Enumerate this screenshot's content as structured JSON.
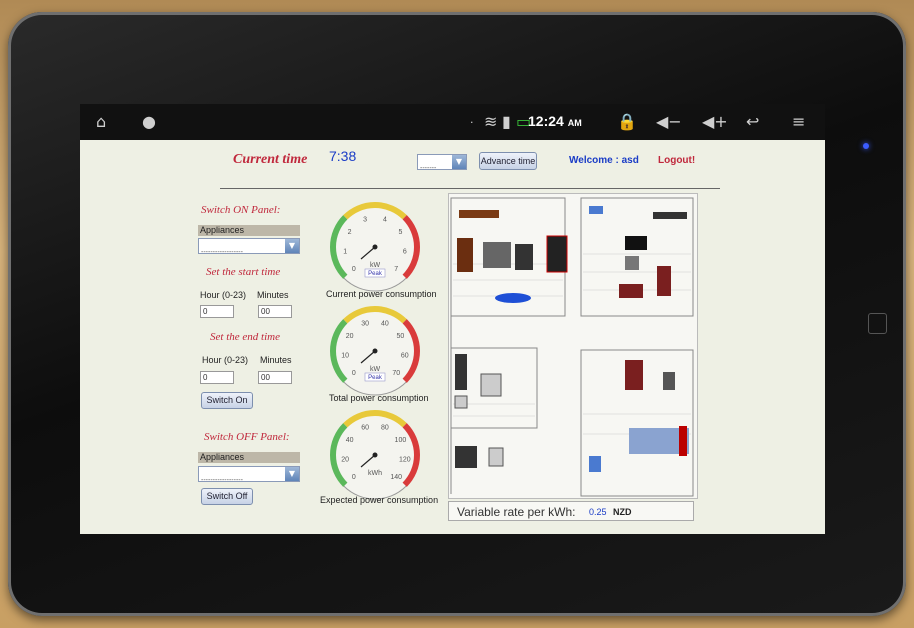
{
  "status_bar": {
    "clock": "12:24",
    "clock_suffix": "AM",
    "icons": [
      "home-icon",
      "android-icon",
      "usb-icon",
      "wifi-icon",
      "signal-icon",
      "battery-icon",
      "lock-icon",
      "volume-down-icon",
      "volume-up-icon",
      "back-icon",
      "menu-icon"
    ]
  },
  "header": {
    "current_time_label": "Current time",
    "current_time_value": "7:38",
    "select_value": "-------",
    "advance_button": "Advance time",
    "welcome": "Welcome : asd",
    "logout": "Logout!"
  },
  "switch_on": {
    "title": "Switch ON Panel:",
    "appliances_label": "Appliances",
    "select_value": "------------------",
    "start_title": "Set the start time",
    "hour_label": "Hour (0-23)",
    "minutes_label": "Minutes",
    "start_hour": "0",
    "start_min": "00",
    "end_title": "Set the end time",
    "end_hour": "0",
    "end_min": "00",
    "button": "Switch On"
  },
  "switch_off": {
    "title": "Switch OFF Panel:",
    "appliances_label": "Appliances",
    "select_value": "------------------",
    "button": "Switch Off"
  },
  "gauges": [
    {
      "caption": "Current power consumption",
      "ticks": [
        "0",
        "1",
        "2",
        "3",
        "4",
        "5",
        "6",
        "7"
      ],
      "unit": "kW",
      "peak": "Peak"
    },
    {
      "caption": "Total power consumption",
      "ticks": [
        "0",
        "10",
        "20",
        "30",
        "40",
        "50",
        "60",
        "70"
      ],
      "unit": "kW",
      "peak": "Peak"
    },
    {
      "caption": "Expected power consumption",
      "ticks": [
        "0",
        "20",
        "40",
        "60",
        "80",
        "100",
        "120",
        "140"
      ],
      "unit": "kWh",
      "peak": ""
    }
  ],
  "rate": {
    "label": "Variable rate per kWh:",
    "value": "0.25",
    "unit": "NZD"
  },
  "colors": {
    "accent_red": "#c0283c",
    "accent_blue": "#1a3cc6"
  }
}
